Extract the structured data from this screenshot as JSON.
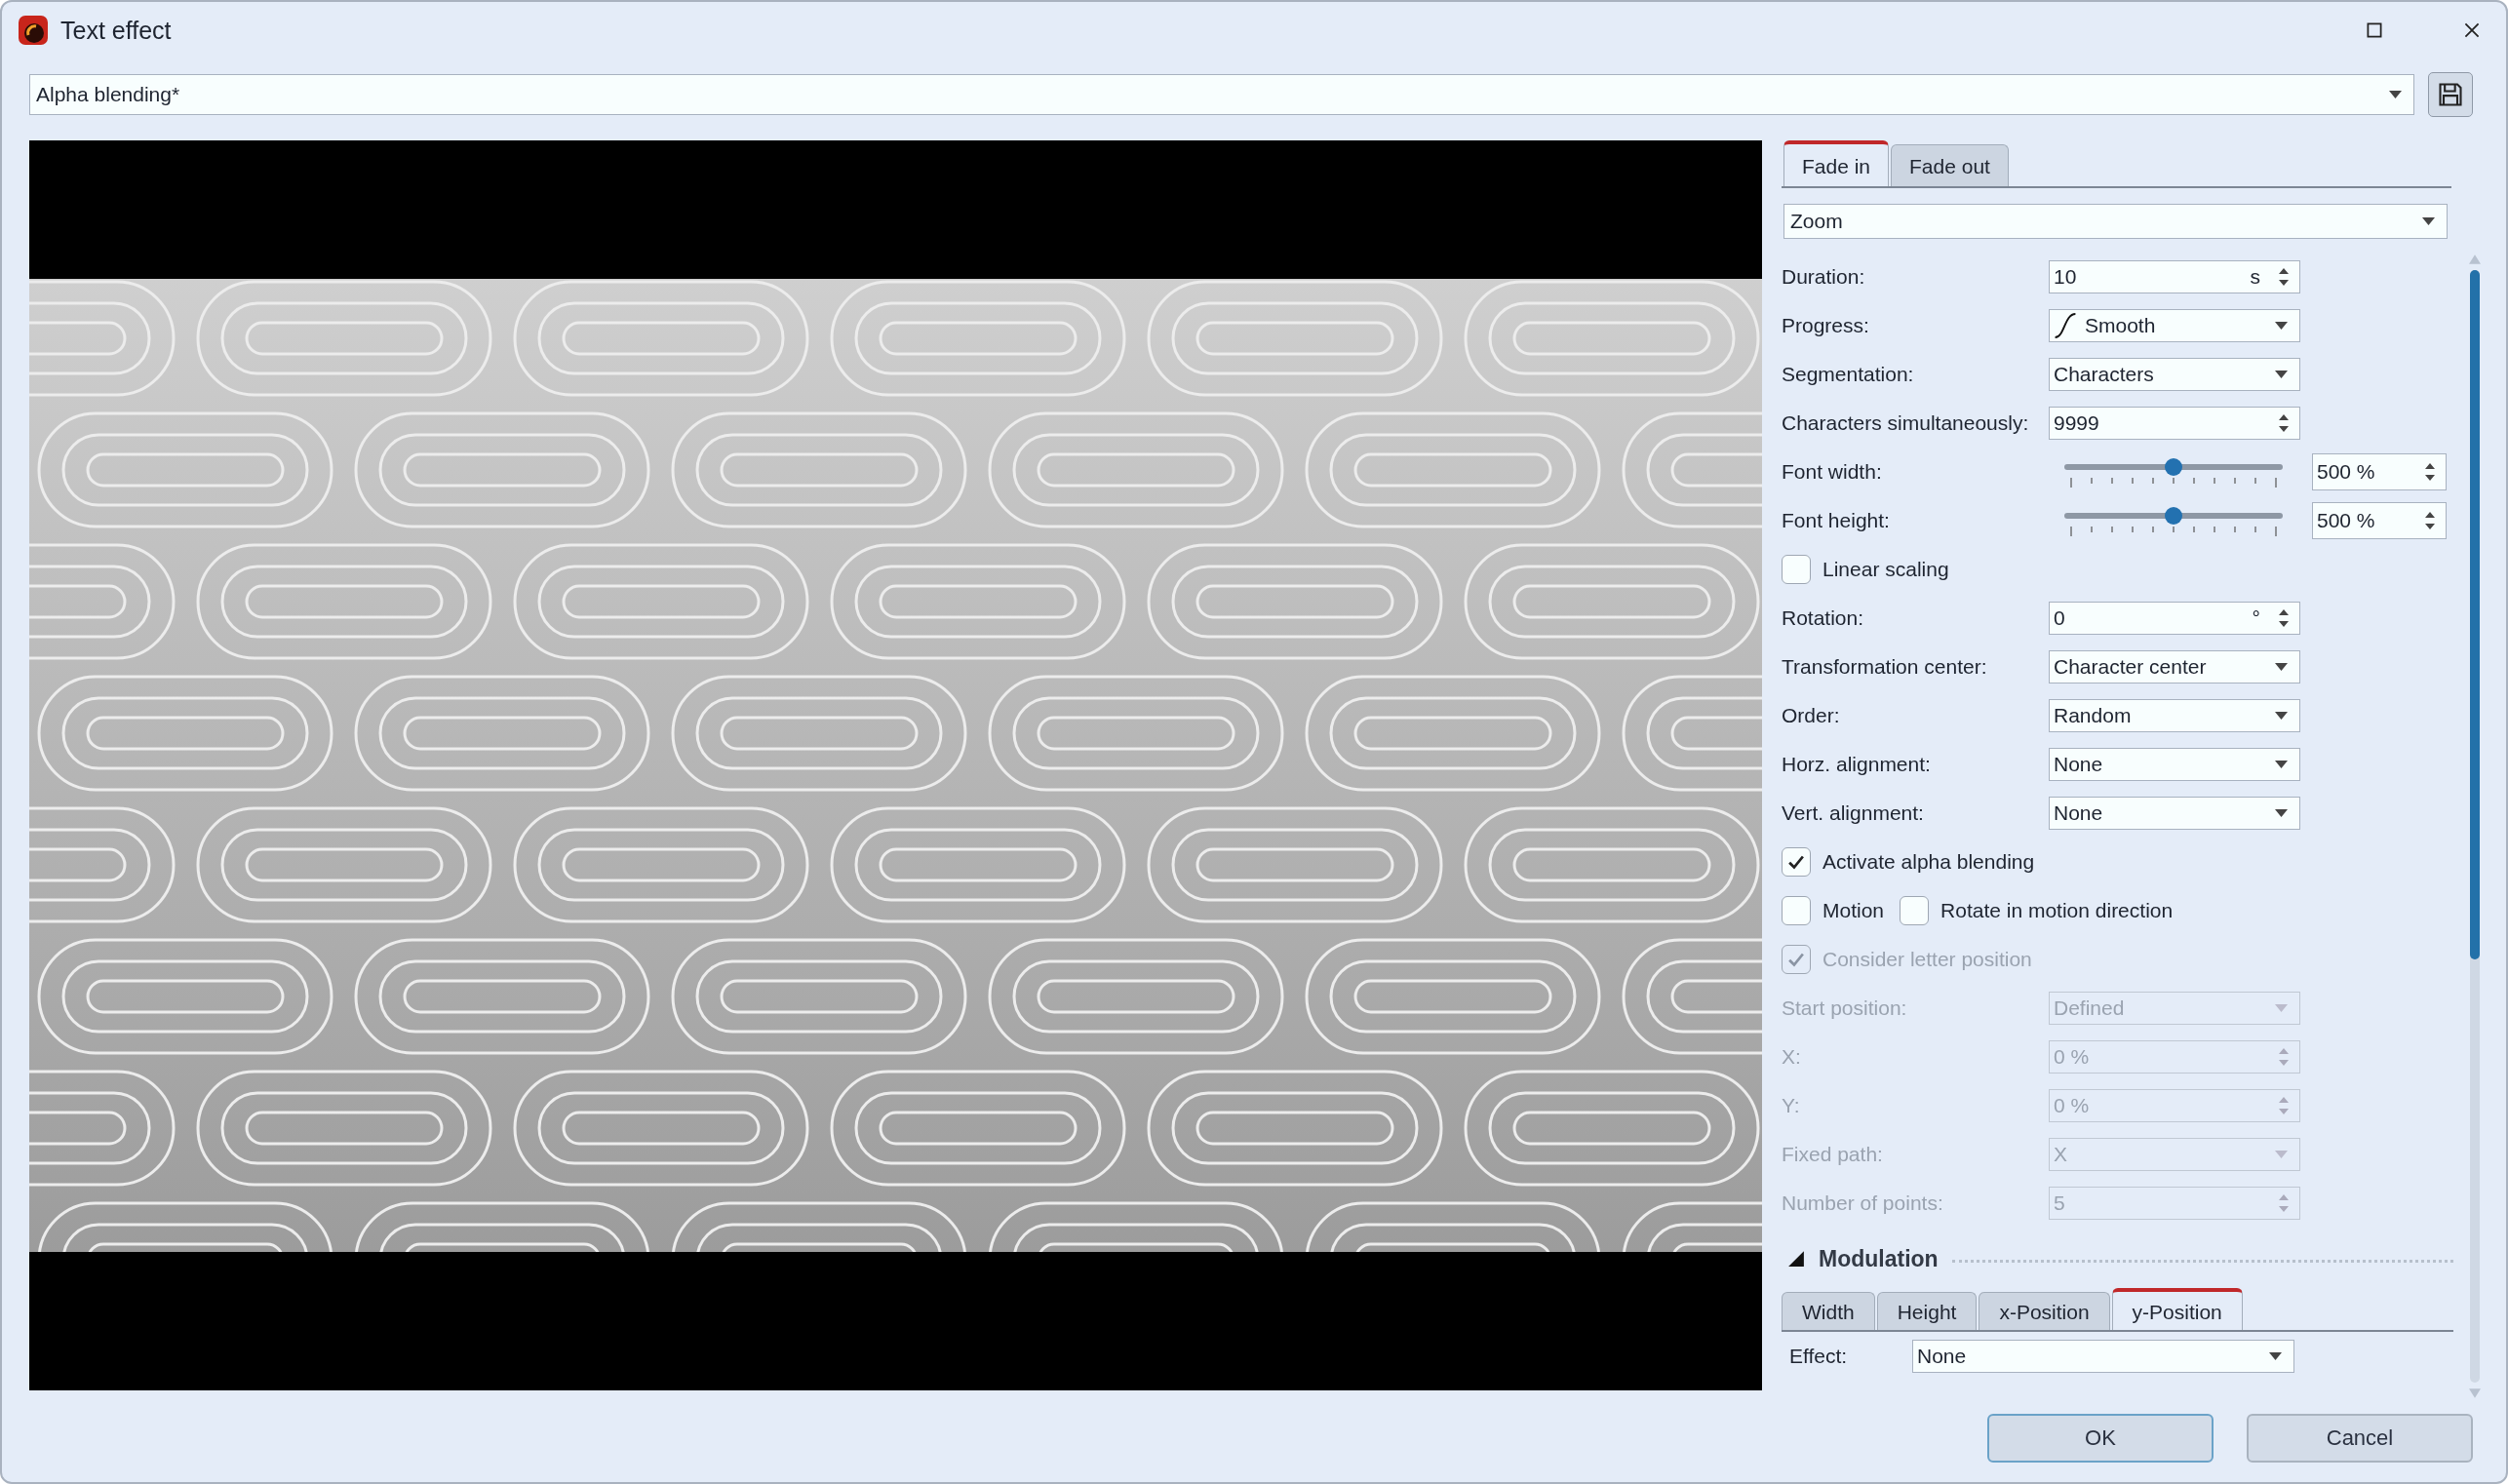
{
  "window": {
    "title": "Text effect"
  },
  "preset": {
    "value": "Alpha blending*"
  },
  "tabs": [
    {
      "label": "Fade in",
      "selected": true
    },
    {
      "label": "Fade out",
      "selected": false
    }
  ],
  "effect": {
    "value": "Zoom"
  },
  "rows": [
    {
      "kind": "spin",
      "label": "Duration:",
      "value": "10",
      "unit": "s",
      "disabled": false
    },
    {
      "kind": "curve-dropdown",
      "label": "Progress:",
      "value": "Smooth",
      "disabled": false
    },
    {
      "kind": "dropdown",
      "label": "Segmentation:",
      "value": "Characters",
      "disabled": false
    },
    {
      "kind": "spin",
      "label": "Characters simultaneously:",
      "value": "9999",
      "disabled": false
    },
    {
      "kind": "slider",
      "label": "Font width:",
      "level": 0.5,
      "value": "500 %",
      "disabled": false
    },
    {
      "kind": "slider",
      "label": "Font height:",
      "level": 0.5,
      "value": "500 %",
      "disabled": false
    },
    {
      "kind": "checkboxes",
      "items": [
        {
          "label": "Linear scaling",
          "checked": false,
          "disabled": false
        }
      ]
    },
    {
      "kind": "spin",
      "label": "Rotation:",
      "value": "0",
      "unit": "°",
      "disabled": false
    },
    {
      "kind": "dropdown",
      "label": "Transformation center:",
      "value": "Character center",
      "disabled": false
    },
    {
      "kind": "dropdown",
      "label": "Order:",
      "value": "Random",
      "disabled": false
    },
    {
      "kind": "dropdown",
      "label": "Horz. alignment:",
      "value": "None",
      "disabled": false
    },
    {
      "kind": "dropdown",
      "label": "Vert. alignment:",
      "value": "None",
      "disabled": false
    },
    {
      "kind": "checkboxes",
      "items": [
        {
          "label": "Activate alpha blending",
          "checked": true,
          "disabled": false
        }
      ]
    },
    {
      "kind": "checkboxes",
      "items": [
        {
          "label": "Motion",
          "checked": false,
          "disabled": false
        },
        {
          "label": "Rotate in motion direction",
          "checked": false,
          "disabled": false
        }
      ]
    },
    {
      "kind": "checkboxes",
      "items": [
        {
          "label": "Consider letter position",
          "checked": true,
          "disabled": true
        }
      ]
    },
    {
      "kind": "dropdown",
      "label": "Start position:",
      "value": "Defined",
      "disabled": true
    },
    {
      "kind": "spin",
      "label": "X:",
      "value": "0 %",
      "disabled": true
    },
    {
      "kind": "spin",
      "label": "Y:",
      "value": "0 %",
      "disabled": true
    },
    {
      "kind": "dropdown",
      "label": "Fixed path:",
      "value": "X",
      "disabled": true
    },
    {
      "kind": "spin",
      "label": "Number of points:",
      "value": "5",
      "disabled": true
    }
  ],
  "modulation": {
    "title": "Modulation",
    "expanded": true,
    "tabs": [
      {
        "label": "Width",
        "selected": false
      },
      {
        "label": "Height",
        "selected": false
      },
      {
        "label": "x-Position",
        "selected": false
      },
      {
        "label": "y-Position",
        "selected": true
      }
    ],
    "effect_label": "Effect:",
    "effect_value": "None"
  },
  "buttons": [
    {
      "label": "OK",
      "default": true
    },
    {
      "label": "Cancel",
      "default": false
    }
  ]
}
